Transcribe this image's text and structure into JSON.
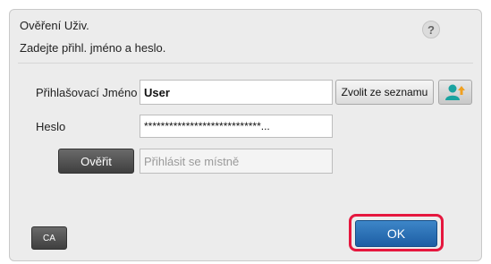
{
  "dialog": {
    "title": "Ověření Uživ.",
    "subtitle": "Zadejte přihl. jméno a heslo.",
    "help_label": "?"
  },
  "form": {
    "login_label": "Přihlašovací Jméno",
    "login_value": "User",
    "choose_list_label": "Zvolit ze seznamu",
    "password_label": "Heslo",
    "password_value": "****************************...",
    "verify_label": "Ověřit",
    "local_login_placeholder": "Přihlásit se místně"
  },
  "footer": {
    "ca_label": "CA",
    "ok_label": "OK"
  },
  "colors": {
    "accent_blue": "#2a6fb5",
    "highlight_red": "#e5173e",
    "icon_teal": "#1aa3a0"
  },
  "icons": {
    "help": "question-mark-icon",
    "address_book": "user-add-icon"
  }
}
